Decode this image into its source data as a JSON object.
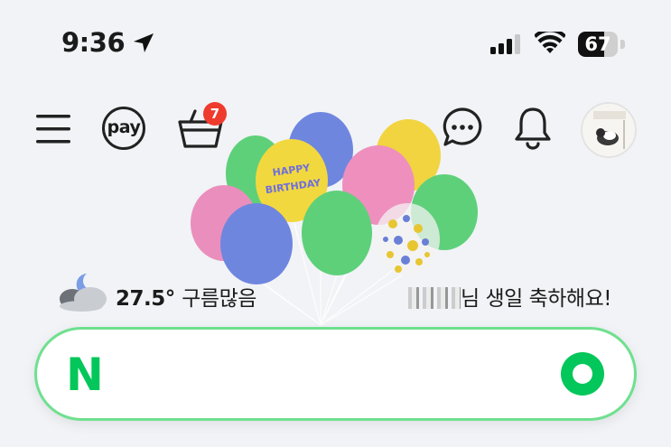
{
  "status_bar": {
    "time": "9:36",
    "battery": "67",
    "battery_level_percent": 67,
    "icons": [
      "location-arrow-icon",
      "cellular-signal-icon",
      "wifi-icon",
      "battery-icon"
    ]
  },
  "header": {
    "pay_label": "pay",
    "cart_badge_count": "7",
    "icons": [
      "hamburger-menu-icon",
      "pay-icon",
      "shopping-bag-icon",
      "chat-bubble-icon",
      "bell-icon",
      "profile-avatar"
    ]
  },
  "weather": {
    "temperature": "27.5°",
    "condition": "구름많음",
    "icon": "cloudy-night-icon"
  },
  "greeting": {
    "suffix": "님 생일 축하해요!"
  },
  "banner": {
    "balloon_text_line1": "HAPPY",
    "balloon_text_line2": "BIRTHDAY"
  },
  "search": {
    "logo": "N",
    "placeholder": "",
    "value": ""
  },
  "colors": {
    "background": "#f1f3f6",
    "naver_green": "#03c75a",
    "search_border": "#6fe08f",
    "badge_red": "#ef3b2e"
  }
}
